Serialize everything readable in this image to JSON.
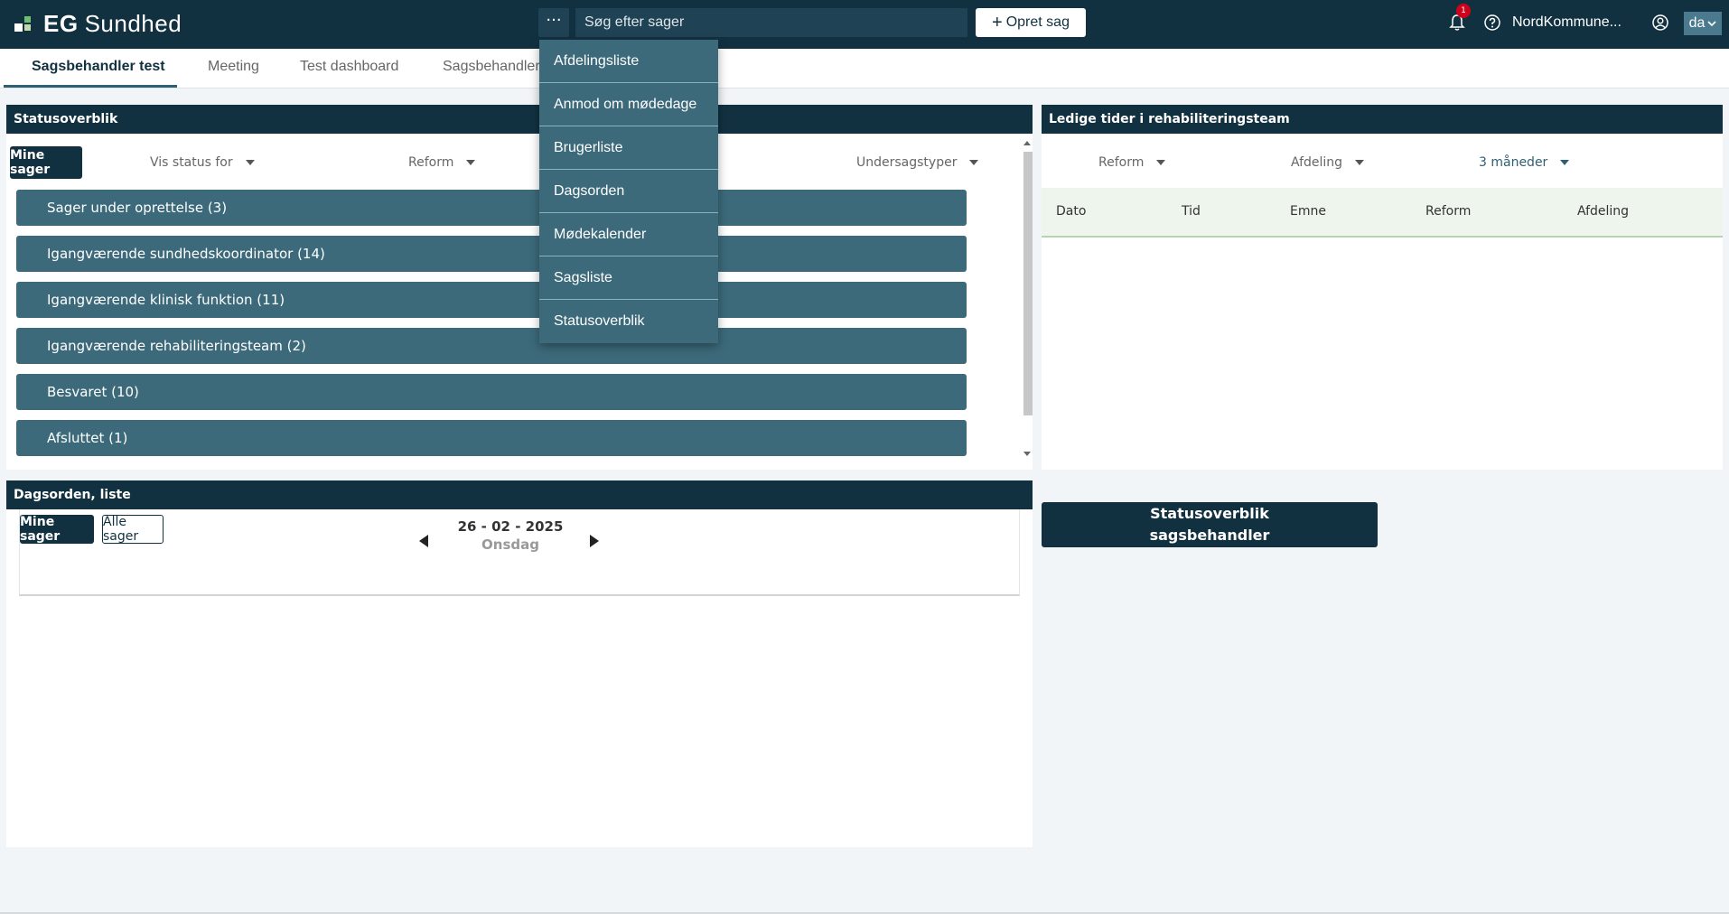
{
  "app": {
    "brand_bold": "EG",
    "brand_rest": "Sundhed"
  },
  "header": {
    "more_label": "···",
    "search_placeholder": "Søg efter sager",
    "create_label": "Opret sag",
    "notification_count": "1",
    "org_name": "NordKommune...",
    "language": "da"
  },
  "tabs": [
    {
      "label": "Sagsbehandler test",
      "active": true
    },
    {
      "label": "Meeting",
      "active": false
    },
    {
      "label": "Test dashboard",
      "active": false
    },
    {
      "label": "Sagsbehandler",
      "active": false
    }
  ],
  "menu": {
    "items": [
      "Afdelingsliste",
      "Anmod om mødedage",
      "Brugerliste",
      "Dagsorden",
      "Mødekalender",
      "Sagsliste",
      "Statusoverblik"
    ]
  },
  "statusoverblik": {
    "title": "Statusoverblik",
    "mine_sager": "Mine sager",
    "filters": [
      "Vis status for",
      "Reform",
      "Undersagstyper"
    ],
    "rows": [
      "Sager under oprettelse  (3)",
      "Igangværende sundhedskoordinator  (14)",
      "Igangværende klinisk funktion  (11)",
      "Igangværende rehabiliteringsteam  (2)",
      "Besvaret  (10)",
      "Afsluttet  (1)"
    ]
  },
  "ledige": {
    "title": "Ledige tider i rehabiliteringsteam",
    "filters": [
      "Reform",
      "Afdeling",
      "3 måneder"
    ],
    "columns": [
      "Dato",
      "Tid",
      "Emne",
      "Reform",
      "Afdeling"
    ]
  },
  "dagsorden": {
    "title": "Dagsorden, liste",
    "mine_sager": "Mine sager",
    "alle_sager": "Alle sager",
    "date": "26 - 02 - 2025",
    "weekday": "Onsdag"
  },
  "statusoverblik_button": {
    "line1": "Statusoverblik",
    "line2": "sagsbehandler"
  },
  "colors": {
    "navy": "#123140",
    "teal": "#3c6a7a",
    "badge_red": "#d0021b"
  }
}
